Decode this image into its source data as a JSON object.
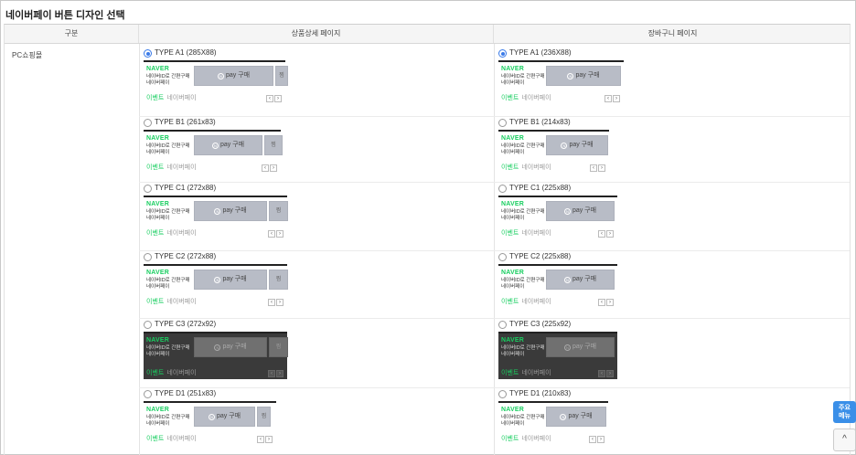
{
  "page_title": "네이버페이 버튼 디자인 선택",
  "table": {
    "headers": [
      "구분",
      "상품상세 페이지",
      "장바구니 페이지"
    ],
    "row_label": "PC쇼핑몰"
  },
  "widget": {
    "brand": "NAVER",
    "desc_line1": "네이버ID로 간편구매",
    "desc_line2": "네이버페이",
    "pay_label": "pay 구매",
    "pay_icon_glyph": "N",
    "zzim_label": "찜",
    "event_label": "이벤트",
    "event_sub": "네이버페이",
    "prev": "‹",
    "next": "›"
  },
  "detail_options": [
    {
      "label": "TYPE A1 (285X88)",
      "selected": true
    },
    {
      "label": "TYPE B1 (261x83)",
      "selected": false
    },
    {
      "label": "TYPE C1 (272x88)",
      "selected": false
    },
    {
      "label": "TYPE C2 (272x88)",
      "selected": false
    },
    {
      "label": "TYPE C3 (272x92)",
      "selected": false
    },
    {
      "label": "TYPE D1 (251x83)",
      "selected": false
    }
  ],
  "cart_options": [
    {
      "label": "TYPE A1 (236X88)",
      "selected": true
    },
    {
      "label": "TYPE B1 (214x83)",
      "selected": false
    },
    {
      "label": "TYPE C1 (225x88)",
      "selected": false
    },
    {
      "label": "TYPE C2 (225x88)",
      "selected": false
    },
    {
      "label": "TYPE C3 (225x92)",
      "selected": false
    },
    {
      "label": "TYPE D1 (210x83)",
      "selected": false
    }
  ],
  "floating": {
    "quick_menu_line1": "주요",
    "quick_menu_line2": "메뉴",
    "top_button": "^"
  },
  "colors": {
    "naver_green": "#19ce60",
    "radio_selected": "#3a7be8",
    "button_gray": "#b8bcc6",
    "dark_bg": "#3a3a3a",
    "quick_menu_blue": "#3a8fe8"
  }
}
